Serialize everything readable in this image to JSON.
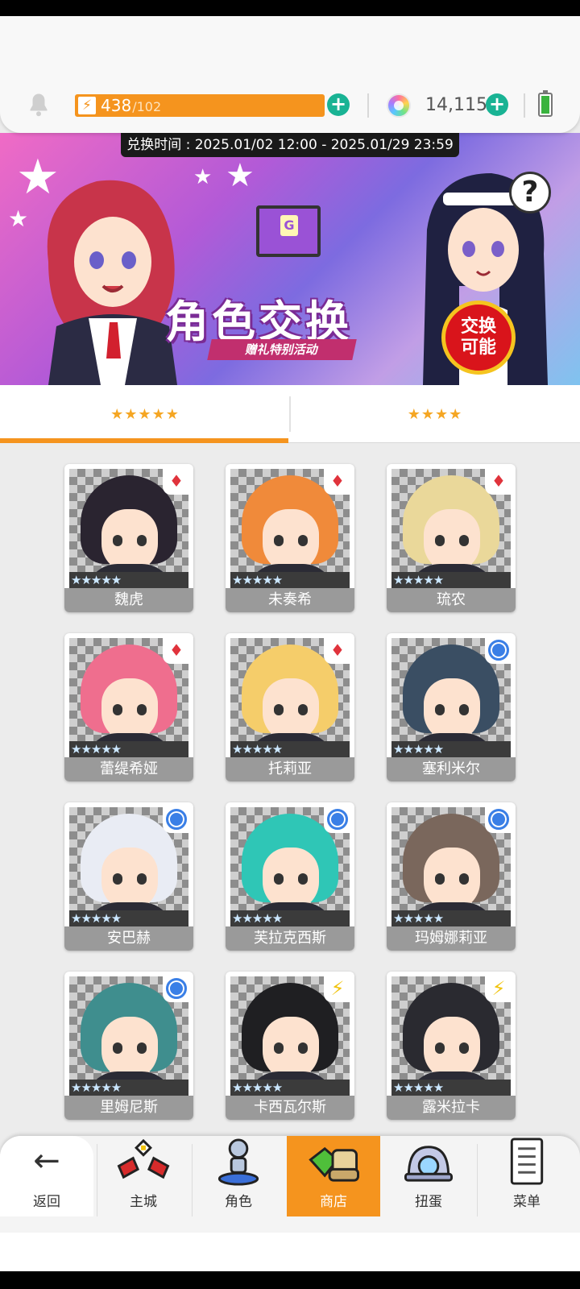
{
  "status": {
    "energy_current": "438",
    "energy_max": "/102",
    "gems": "14,115"
  },
  "banner": {
    "exchange_time": "兑换时间 : 2025.01/02 12:00 - 2025.01/29 23:59",
    "title": "角色交换",
    "subtitle": "赠礼特别活动",
    "badge": "交换可能"
  },
  "tabs": [
    {
      "label": "★★★★★",
      "active": true
    },
    {
      "label": "★★★★",
      "active": false
    }
  ],
  "stars_label": "★★★★★",
  "characters": [
    {
      "name": "魏虎",
      "element": "diamond",
      "hair": "#2a2430"
    },
    {
      "name": "未奏希",
      "element": "diamond",
      "hair": "#f08a3a"
    },
    {
      "name": "琉农",
      "element": "diamond",
      "hair": "#ead89a"
    },
    {
      "name": "蕾缇希娅",
      "element": "diamond",
      "hair": "#ef6e8e"
    },
    {
      "name": "托莉亚",
      "element": "diamond",
      "hair": "#f5cd6a"
    },
    {
      "name": "塞利米尔",
      "element": "circle",
      "hair": "#3a4e63"
    },
    {
      "name": "安巴赫",
      "element": "circle",
      "hair": "#e9ecf4"
    },
    {
      "name": "芙拉克西斯",
      "element": "circle",
      "hair": "#2fc6b6"
    },
    {
      "name": "玛姆娜莉亚",
      "element": "circle",
      "hair": "#7a675c"
    },
    {
      "name": "里姆尼斯",
      "element": "circle",
      "hair": "#3f8e8e"
    },
    {
      "name": "卡西瓦尔斯",
      "element": "bolt",
      "hair": "#1f1f22"
    },
    {
      "name": "露米拉卡",
      "element": "bolt",
      "hair": "#2a2a30"
    }
  ],
  "bottom_nav": [
    {
      "label": "返回",
      "icon": "back-arrow-icon"
    },
    {
      "label": "主城",
      "icon": "castle-icon"
    },
    {
      "label": "角色",
      "icon": "character-icon"
    },
    {
      "label": "商店",
      "icon": "shop-icon",
      "active": true
    },
    {
      "label": "扭蛋",
      "icon": "gacha-icon"
    },
    {
      "label": "菜单",
      "icon": "menu-icon"
    }
  ],
  "colors": {
    "accent": "#f5941e",
    "name_bar": "#9a9a9a"
  }
}
